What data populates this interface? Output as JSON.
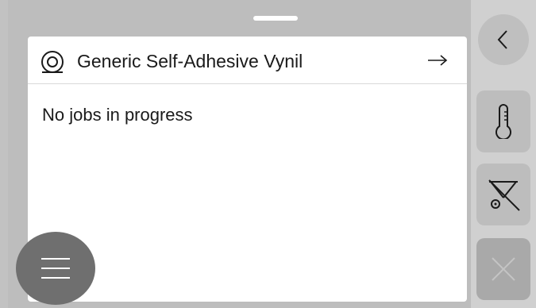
{
  "media": {
    "name": "Generic Self-Adhesive Vynil",
    "icon": "media-roll-icon",
    "arrow_icon": "arrow-right-icon"
  },
  "status": {
    "text": "No jobs in progress"
  },
  "menu": {
    "icon": "hamburger-menu-icon"
  },
  "rail": {
    "back_icon": "chevron-left-icon",
    "temperature_icon": "thermometer-icon",
    "cutter_icon": "cutter-off-icon",
    "cancel_icon": "close-icon"
  },
  "colors": {
    "background": "#c2c2c2",
    "card": "#ffffff",
    "menu_button": "#6f6f6f",
    "rail": "#d0d0d0",
    "rail_button": "#bdbdbd",
    "cancel_button": "#a9a9a9"
  }
}
